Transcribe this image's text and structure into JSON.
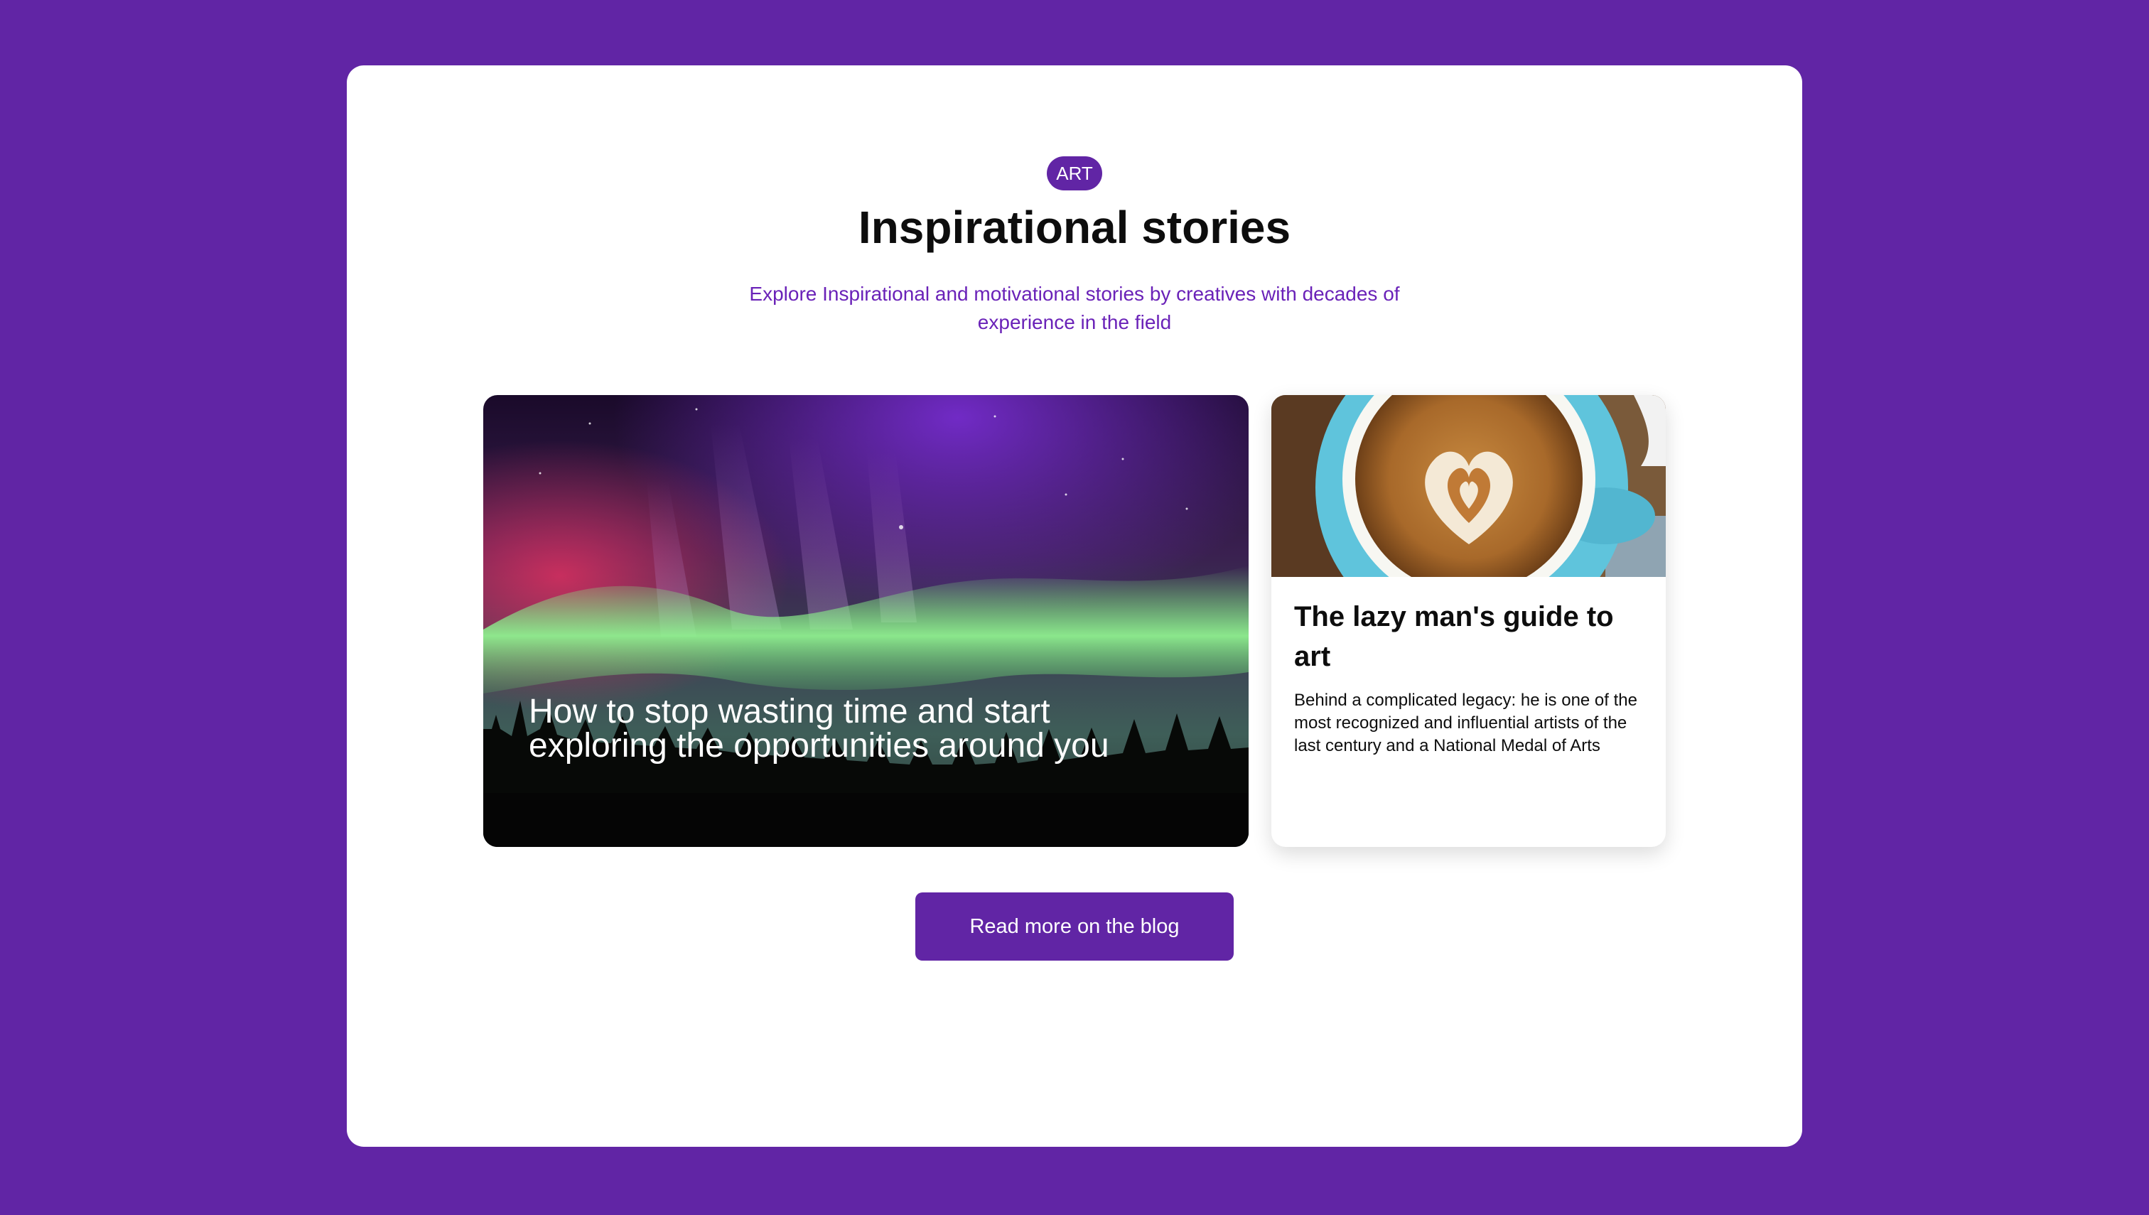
{
  "colors": {
    "background": "#6125a5",
    "accent": "#6125a5",
    "subtitle": "#6a22b8",
    "card": "#ffffff"
  },
  "header": {
    "badge": "ART",
    "title": "Inspirational stories",
    "subtitle": "Explore Inspirational and motivational stories by creatives with decades of experience in the field"
  },
  "featured_story": {
    "image": "aurora-over-forest-photo",
    "title": "How to stop wasting time and start exploring the opportunities around you"
  },
  "side_story": {
    "image": "latte-art-coffee-cup-photo",
    "title": "The lazy man's guide to art",
    "description": "Behind a complicated legacy: he is one of the most recognized and influential artists of the last century and a National Medal of Arts"
  },
  "cta": {
    "label": "Read more on the blog"
  }
}
